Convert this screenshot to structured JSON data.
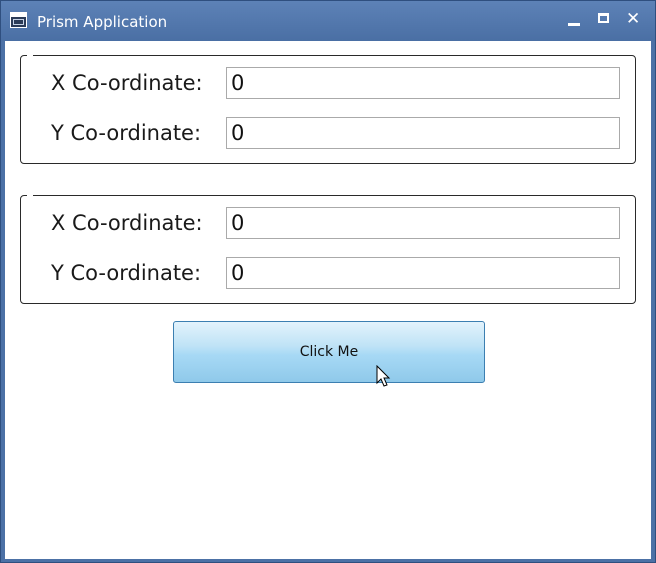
{
  "window": {
    "title": "Prism Application",
    "icon": "app-window-icon",
    "controls": {
      "minimize": "minimize-icon",
      "maximize": "maximize-icon",
      "close": "close-icon"
    }
  },
  "groups": [
    {
      "x_label": "X Co-ordinate:",
      "x_value": "0",
      "y_label": "Y Co-ordinate:",
      "y_value": "0"
    },
    {
      "x_label": "X Co-ordinate:",
      "x_value": "0",
      "y_label": "Y Co-ordinate:",
      "y_value": "0"
    }
  ],
  "button": {
    "label": "Click Me"
  },
  "colors": {
    "titlebar": "#4c71a6",
    "button_top": "#e3f3fc",
    "button_bottom": "#8fc9ea",
    "button_border": "#3c7fb1"
  }
}
